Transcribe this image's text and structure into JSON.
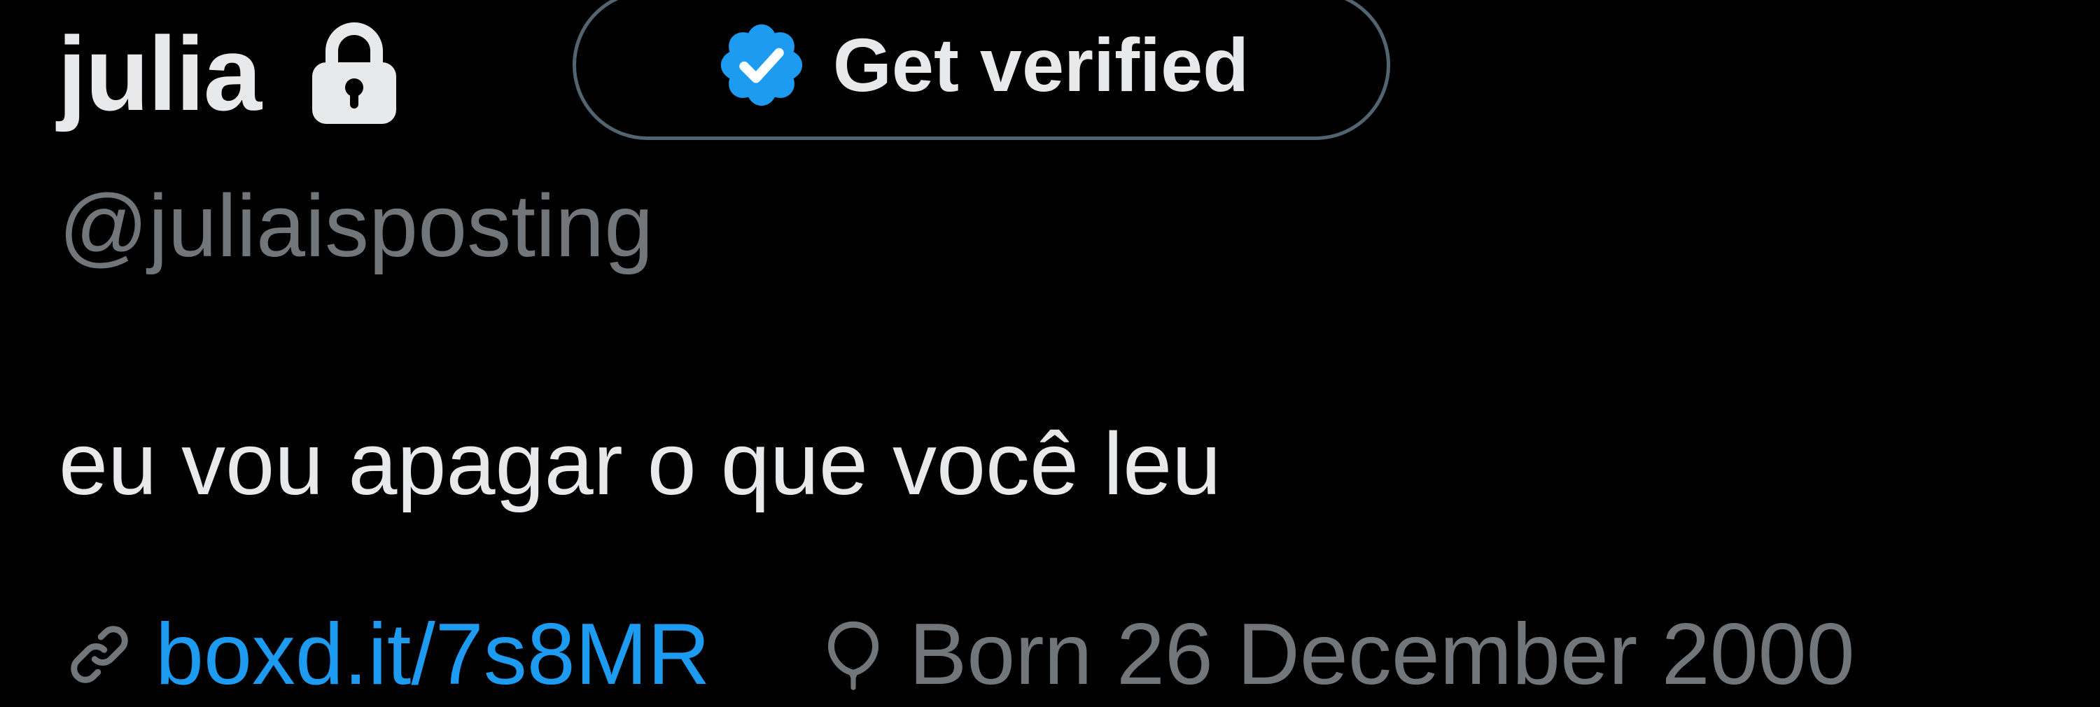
{
  "profile": {
    "display_name": "julia",
    "handle": "@juliaisposting",
    "bio": "eu vou apagar o que você leu",
    "protected_icon": "lock-icon"
  },
  "verify": {
    "label": "Get verified",
    "icon": "verified-badge-icon"
  },
  "meta": {
    "link": {
      "icon": "link-icon",
      "text": "boxd.it/7s8MR"
    },
    "birthday": {
      "icon": "balloon-icon",
      "text": "Born 26 December 2000"
    }
  },
  "colors": {
    "background": "#000000",
    "primary_text": "#e7e9ea",
    "secondary_text": "#71767b",
    "accent": "#1d9bf0",
    "border": "#536471"
  }
}
